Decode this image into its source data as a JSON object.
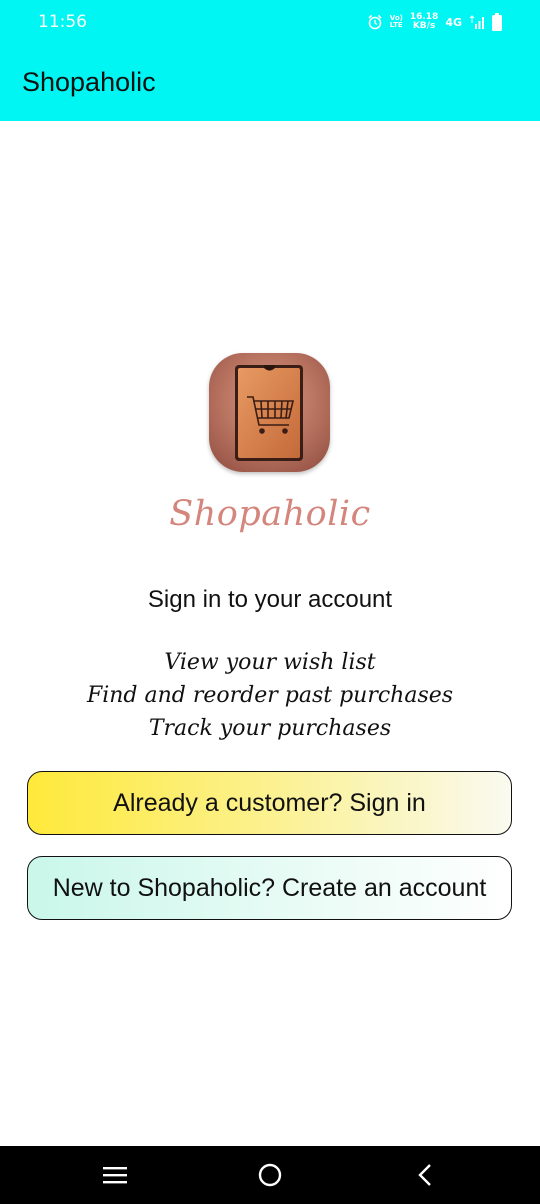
{
  "status_bar": {
    "time": "11:56",
    "volte_top": "Vo)",
    "volte_bottom": "LTE",
    "speed_value": "16.18",
    "speed_unit": "KB/s",
    "network": "4G",
    "icons": [
      "alarm-icon",
      "signal-icon",
      "battery-icon"
    ]
  },
  "app_bar": {
    "title": "Shopaholic"
  },
  "main": {
    "logo_icon": "shopping-cart-tablet-icon",
    "brand_name": "Shopaholic",
    "heading": "Sign in to your account",
    "benefits": [
      "View your wish list",
      "Find and reorder past purchases",
      "Track your purchases"
    ],
    "sign_in_button": "Already a customer? Sign in",
    "create_account_button": "New to Shopaholic? Create an account"
  },
  "nav_bar": {
    "icons": [
      "menu-icon",
      "home-icon",
      "back-icon"
    ]
  },
  "colors": {
    "app_bar": "#00F6F2",
    "brand_text": "#d4857c",
    "sign_in_gradient_start": "#FFE93A",
    "create_gradient_start": "#C9F7EA",
    "nav_bar": "#000000"
  }
}
